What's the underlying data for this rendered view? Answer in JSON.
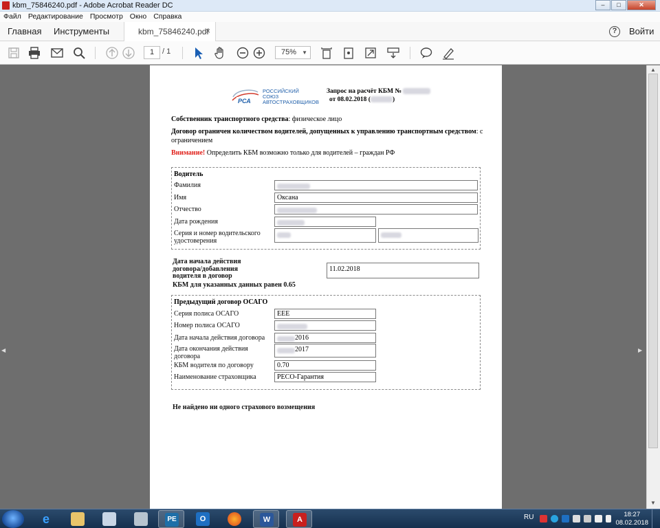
{
  "window": {
    "title": "kbm_75846240.pdf - Adobe Acrobat Reader DC"
  },
  "menu": [
    "Файл",
    "Редактирование",
    "Просмотр",
    "Окно",
    "Справка"
  ],
  "tabs": {
    "home": "Главная",
    "tools": "Инструменты",
    "document": "kbm_75846240.pdf",
    "close": "×",
    "help": "?",
    "signin": "Войти"
  },
  "toolbar": {
    "page_current": "1",
    "page_total": "/ 1",
    "zoom": "75%"
  },
  "doc": {
    "logo_text": [
      "РОССИЙСКИЙ",
      "СОЮЗ",
      "АВТОСТРАХОВЩИКОВ"
    ],
    "logo_mark": "РСА",
    "request_title": "Запрос на расчёт КБМ №",
    "request_date": "от 08.02.2018 (",
    "request_date_close": ")",
    "owner_label": "Собственник транспортного средства",
    "owner_value": ": физическое лицо",
    "contract_label": "Договор ограничен количеством водителей, допущенных к управлению транспортным средством",
    "contract_value": ": с",
    "contract_value2": "ограничением",
    "warning_label": "Внимание!",
    "warning_text": " Определить КБМ возможно только для водителей – граждан РФ",
    "driver": {
      "header": "Водитель",
      "surname_label": "Фамилия",
      "name_label": "Имя",
      "name_value": "Оксана",
      "patronymic_label": "Отчество",
      "birthdate_label": "Дата рождения",
      "license_label_1": "Серия и номер водительского",
      "license_label_2": "удостоверения"
    },
    "start_label_1": "Дата начала действия",
    "start_label_2": "договора/добавления",
    "start_label_3": "водителя в договор",
    "start_value": "11.02.2018",
    "kbm_result": "КБМ для указанных данных равен 0.65",
    "prev": {
      "header": "Предыдущий договор ОСАГО",
      "series_label": "Серия полиса ОСАГО",
      "series_value": "ЕЕЕ",
      "number_label": "Номер полиса ОСАГО",
      "start_label": "Дата начала действия договора",
      "start_year": "2016",
      "end_label_1": "Дата окончания действия",
      "end_label_2": "договора",
      "end_year": "2017",
      "kbm_label": "КБМ водителя по договору",
      "kbm_value": "0.70",
      "insurer_label": "Наименование страховщика",
      "insurer_value": "РЕСО-Гарантия"
    },
    "no_claims": "Не найдено ни одного страхового возмещения"
  },
  "taskbar": {
    "lang": "RU",
    "time": "18:27",
    "date": "08.02.2018"
  },
  "colors": {
    "warning": "#e0201a",
    "acrobat_red": "#c8201e",
    "taskbar": "#1f3b5c"
  }
}
